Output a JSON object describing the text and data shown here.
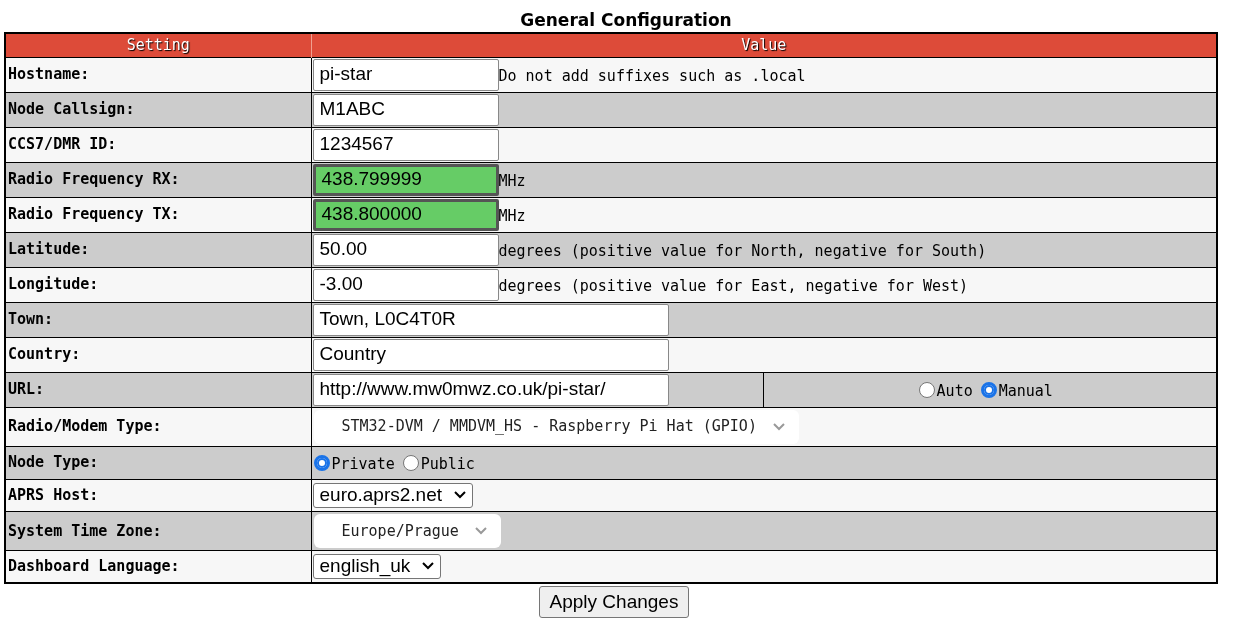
{
  "title": "General Configuration",
  "columns": [
    "Setting",
    "Value"
  ],
  "rows": [
    {
      "kind": "input",
      "label": "Hostname:",
      "value": "pi-star",
      "highlighted": false,
      "note": "Do not add suffixes such as .local"
    },
    {
      "kind": "input",
      "label": "Node Callsign:",
      "value": "M1ABC",
      "highlighted": false
    },
    {
      "kind": "input",
      "label": "CCS7/DMR ID:",
      "value": "1234567",
      "highlighted": false
    },
    {
      "kind": "input",
      "label": "Radio Frequency RX:",
      "value": "438.799999",
      "highlighted": true,
      "note": "MHz"
    },
    {
      "kind": "input",
      "label": "Radio Frequency TX:",
      "value": "438.800000",
      "highlighted": true,
      "note": "MHz"
    },
    {
      "kind": "input",
      "label": "Latitude:",
      "value": "50.00",
      "highlighted": false,
      "note": "degrees (positive value for North, negative for South)"
    },
    {
      "kind": "input",
      "label": "Longitude:",
      "value": "-3.00",
      "highlighted": false,
      "note": "degrees (positive value for East, negative for West)"
    },
    {
      "kind": "wide_input",
      "label": "Town:",
      "value": "Town, L0C4T0R"
    },
    {
      "kind": "wide_input",
      "label": "Country:",
      "value": "Country"
    },
    {
      "kind": "wide_input",
      "label": "URL:",
      "value": "http://www.mw0mwz.co.uk/pi-star/",
      "options": [
        {
          "label": "Auto",
          "selected": false
        },
        {
          "label": "Manual",
          "selected": true
        }
      ]
    },
    {
      "kind": "styled_select",
      "label": "Radio/Modem Type:",
      "value": "STM32-DVM / MMDVM_HS - Raspberry Pi Hat (GPIO)"
    },
    {
      "kind": "radio",
      "label": "Node Type:",
      "options": [
        {
          "label": "Private",
          "selected": true
        },
        {
          "label": "Public",
          "selected": false
        }
      ]
    },
    {
      "kind": "select",
      "label": "APRS Host:",
      "value": "euro.aprs2.net"
    },
    {
      "kind": "styled_select",
      "label": "System Time Zone:",
      "value": "Europe/Prague"
    },
    {
      "kind": "select",
      "label": "Dashboard Language:",
      "value": "english_uk"
    }
  ],
  "button": "Apply Changes"
}
